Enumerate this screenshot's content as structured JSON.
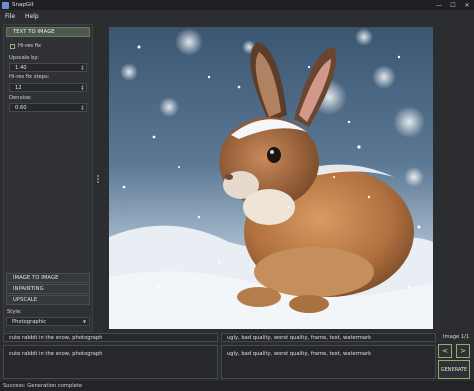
{
  "window": {
    "title": "SnapGit",
    "controls": [
      "—",
      "☐",
      "✕"
    ]
  },
  "menu": {
    "items": [
      "File",
      "Help"
    ]
  },
  "sidebar": {
    "text_to_image_label": "TEXT TO IMAGE",
    "hires_fix": {
      "label": "Hi-res fix",
      "checked": false
    },
    "upscale_by": {
      "label": "Upscale by:",
      "value": "1.40"
    },
    "hires_steps": {
      "label": "Hi-res fix steps:",
      "value": "12"
    },
    "denoise": {
      "label": "Denoise:",
      "value": "0.60"
    },
    "image_to_image_label": "IMAGE TO IMAGE",
    "inpainting_label": "INPAINTING",
    "upscale_label": "UPSCALE",
    "style": {
      "label": "Style:",
      "value": "Photographic"
    }
  },
  "prompt": {
    "positive_single": "cute rabbit in the snow, photograph",
    "negative_single": "ugly, bad quality, worst quality, frame, text, watermark",
    "positive_text": "cute rabbit in the snow, photograph",
    "negative_text": "ugly, bad quality, worst quality, frame, text, watermark"
  },
  "viewer": {
    "image_count": "Image 1/1",
    "prev_label": "<",
    "next_label": ">",
    "generate_label": "GENERATE"
  },
  "status": {
    "text": "Success: Generation complete"
  },
  "colors": {
    "accent": "#8eae6e",
    "active_tab": "#4d5a4a",
    "background": "#2b2d30"
  }
}
